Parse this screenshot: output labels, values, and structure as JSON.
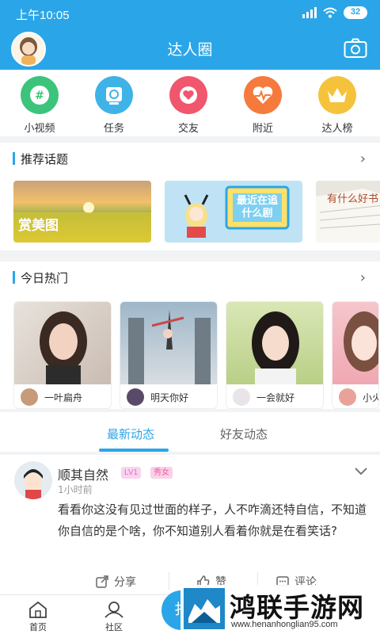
{
  "status_bar": {
    "time": "上午10:05",
    "battery": "32"
  },
  "header": {
    "title": "达人圈"
  },
  "quick_icons": [
    {
      "label": "小视频",
      "icon": "hashtag-icon",
      "color": "#3cc47c"
    },
    {
      "label": "任务",
      "icon": "task-icon",
      "color": "#3fb3e8"
    },
    {
      "label": "交友",
      "icon": "heart-icon",
      "color": "#f0566d"
    },
    {
      "label": "附近",
      "icon": "pulse-icon",
      "color": "#f57a3c"
    },
    {
      "label": "达人榜",
      "icon": "crown-icon",
      "color": "#f5c33b"
    }
  ],
  "recommended": {
    "title": "推荐话题",
    "cards": [
      {
        "caption": "赏美图"
      },
      {
        "caption": "最近在追什么剧"
      },
      {
        "caption": "有什么好书"
      }
    ]
  },
  "hot_today": {
    "title": "今日热门",
    "cards": [
      {
        "user": "一叶扁舟"
      },
      {
        "user": "明天你好"
      },
      {
        "user": "一会就好"
      },
      {
        "user": "小火"
      }
    ]
  },
  "feed_tabs": {
    "active": "最新动态",
    "inactive": "好友动态"
  },
  "post": {
    "name": "顺其自然",
    "level": "LV1",
    "tag": "秀女",
    "time": "1小时前",
    "text": "看看你这没有见过世面的样子，人不咋滴还特自信，不知道你自信的是个啥，你不知道别人看着你就是在看笑话?",
    "actions": {
      "share": "分享",
      "like": "赞",
      "comment": "评论"
    }
  },
  "bottom_nav": {
    "home": "首页",
    "community": "社区",
    "publish": "扌"
  },
  "watermark": {
    "title": "鸿联手游网",
    "url": "www.henanhonglian95.com"
  }
}
